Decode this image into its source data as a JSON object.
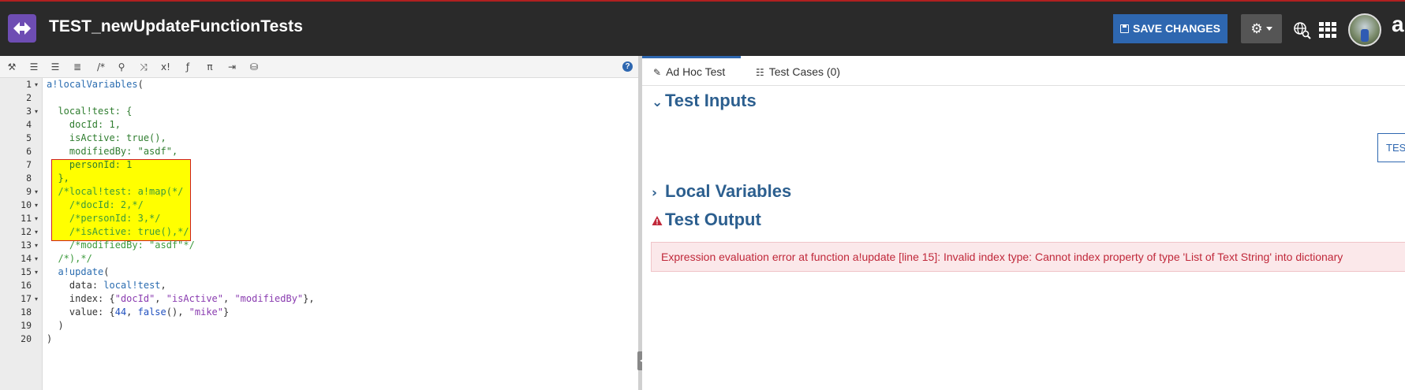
{
  "app": {
    "title": "TEST_newUpdateFunctionTests",
    "brand_partial": "a",
    "accent": "#2e67b0"
  },
  "header": {
    "save_label": "SAVE CHANGES",
    "icons": [
      "settings-gear-icon",
      "globe-search-icon",
      "apps-grid-icon",
      "avatar"
    ]
  },
  "toolbar": {
    "icons": [
      "magic-wand-icon",
      "outdent-icon",
      "indent-icon",
      "list-icon",
      "comment-icon",
      "search-icon",
      "shuffle-icon",
      "x-factorial-icon",
      "function-icon",
      "pi-icon",
      "export-icon",
      "database-search-icon"
    ],
    "help": "?"
  },
  "editor": {
    "line_numbers": [
      "1",
      "2",
      "3",
      "4",
      "5",
      "6",
      "7",
      "8",
      "9",
      "10",
      "11",
      "12",
      "13",
      "14",
      "15",
      "16",
      "17",
      "18",
      "19",
      "20"
    ],
    "fold_markers": {
      "1": "▾",
      "3": "▾",
      "9": "▾",
      "10": "▾",
      "11": "▾",
      "12": "▾",
      "13": "▾",
      "14": "▾",
      "15": "▾",
      "17": "▾"
    },
    "lines": [
      "a!localVariables(",
      "",
      "  local!test: {",
      "    docId: 1,",
      "    isActive: true(),",
      "    modifiedBy: \"asdf\",",
      "    personId: 1",
      "  },",
      "  /*local!test: a!map(*/",
      "    /*docId: 2,*/",
      "    /*personId: 3,*/",
      "    /*isActive: true(),*/",
      "    /*modifiedBy: \"asdf\"*/",
      "  /*),*/",
      "  a!update(",
      "    data: local!test,",
      "    index: {\"docId\", \"isActive\", \"modifiedBy\"},",
      "    value: {44, false(), \"mike\"}",
      "  )",
      ")"
    ]
  },
  "right": {
    "tabs": [
      {
        "label": "Ad Hoc Test",
        "icon": "edit-icon"
      },
      {
        "label": "Test Cases (0)",
        "icon": "list-icon"
      }
    ],
    "sections": {
      "inputs": "Test Inputs",
      "locals": "Local Variables",
      "output": "Test Output"
    },
    "test_button": "TEST",
    "error_message": "Expression evaluation error at function a!update [line 15]: Invalid index type: Cannot index property of type 'List of Text String' into dictionary",
    "error_color": "#c0283a"
  }
}
